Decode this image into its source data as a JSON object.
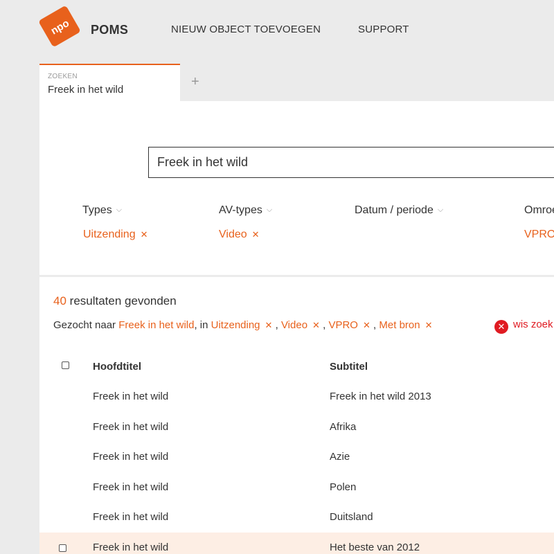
{
  "header": {
    "brand": "POMS",
    "logo_text": "npo",
    "nav": [
      "NIEUW OBJECT TOEVOEGEN",
      "SUPPORT"
    ]
  },
  "tabs": {
    "active_label": "ZOEKEN",
    "active_value": "Freek in het wild",
    "add_symbol": "+"
  },
  "search": {
    "value": "Freek in het wild"
  },
  "filters": [
    {
      "label": "Types",
      "value": "Uitzending"
    },
    {
      "label": "AV-types",
      "value": "Video"
    },
    {
      "label": "Datum / periode",
      "value": ""
    },
    {
      "label": "Omroe",
      "value": "VPRO"
    }
  ],
  "results": {
    "count": "40",
    "count_text": "resultaten gevonden",
    "searched_prefix": "Gezocht naar",
    "searched_query": "Freek in het wild",
    "searched_in": ", in",
    "searched_terms": [
      "Uitzending",
      "Video",
      "VPRO",
      "Met bron"
    ],
    "clear_label": "wis zoek"
  },
  "table": {
    "columns": [
      "Hoofdtitel",
      "Subtitel"
    ],
    "rows": [
      {
        "title": "Freek in het wild",
        "subtitle": "Freek in het wild 2013"
      },
      {
        "title": "Freek in het wild",
        "subtitle": "Afrika"
      },
      {
        "title": "Freek in het wild",
        "subtitle": "Azie"
      },
      {
        "title": "Freek in het wild",
        "subtitle": "Polen"
      },
      {
        "title": "Freek in het wild",
        "subtitle": "Duitsland"
      },
      {
        "title": "Freek in het wild",
        "subtitle": "Het beste van 2012"
      }
    ]
  },
  "colors": {
    "accent": "#e8611c",
    "danger": "#e01b22",
    "highlight_row": "#fdeee4"
  }
}
